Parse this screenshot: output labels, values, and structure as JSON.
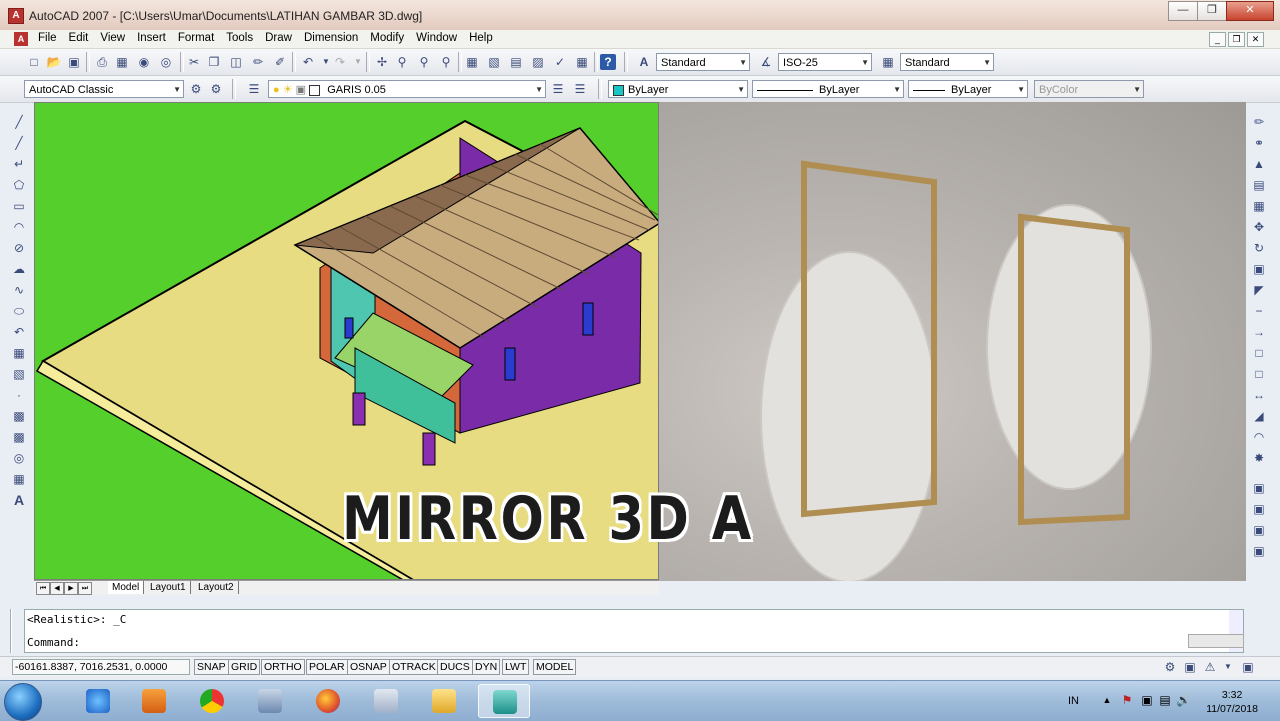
{
  "window": {
    "title": "AutoCAD 2007 - [C:\\Users\\Umar\\Documents\\LATIHAN GAMBAR 3D.dwg]"
  },
  "menu": [
    "File",
    "Edit",
    "View",
    "Insert",
    "Format",
    "Tools",
    "Draw",
    "Dimension",
    "Modify",
    "Window",
    "Help"
  ],
  "toolbar1": {
    "text_style": "Standard",
    "dim_style": "ISO-25",
    "table_style": "Standard"
  },
  "toolbar2": {
    "workspace": "AutoCAD Classic",
    "layer": "GARIS 0.05",
    "color": "ByLayer",
    "linetype": "ByLayer",
    "lineweight": "ByLayer",
    "plotstyle": "ByColor"
  },
  "overlay": {
    "title": "MIRROR 3D A"
  },
  "tabs": [
    "Model",
    "Layout1",
    "Layout2"
  ],
  "command": {
    "line1": "<Realistic>: _C",
    "line2": "Command:"
  },
  "status": {
    "coords": "-60161.8387, 7016.2531, 0.0000",
    "buttons": [
      "SNAP",
      "GRID",
      "ORTHO",
      "POLAR",
      "OSNAP",
      "OTRACK",
      "DUCS",
      "DYN",
      "LWT",
      "MODEL"
    ]
  },
  "tray": {
    "language": "IN",
    "time": "3:32",
    "date": "11/07/2018"
  },
  "colors": {
    "background_green": "#54cf2c",
    "ground": "#e8dc82",
    "roof": "#c9ac7e",
    "wall_purple": "#7a2ca8",
    "wall_orange": "#d5683a",
    "porch": "#98d468"
  }
}
